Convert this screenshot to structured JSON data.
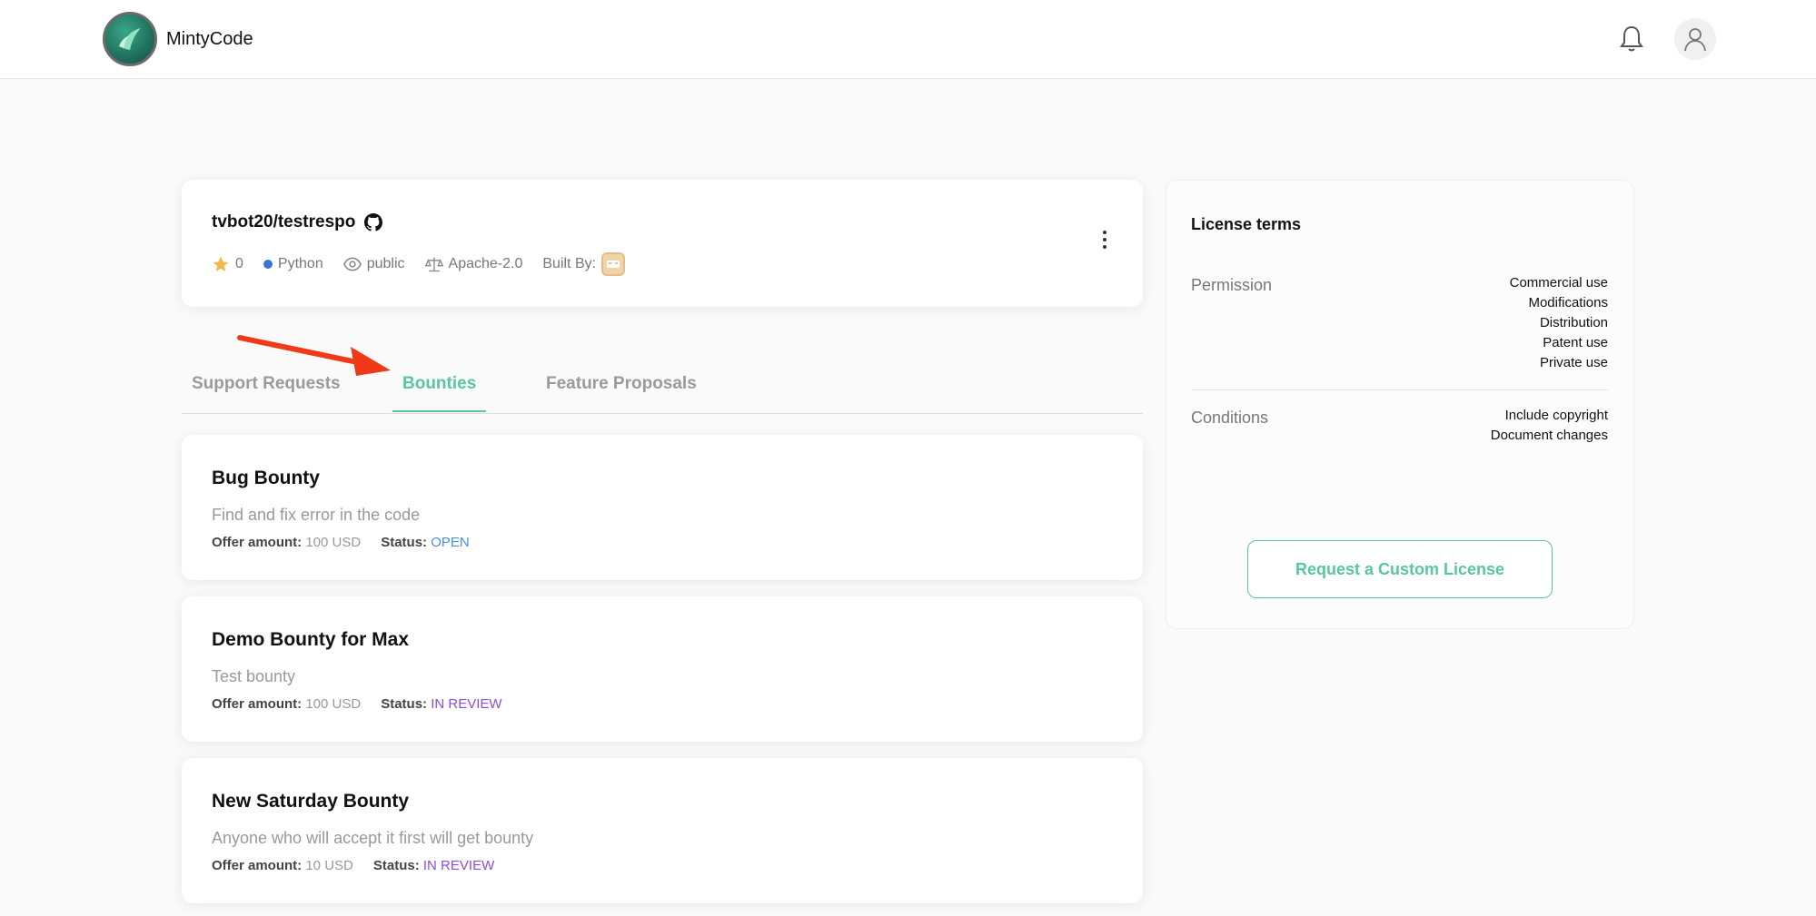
{
  "header": {
    "app_name": "MintyCode"
  },
  "repo": {
    "name": "tvbot20/testrespo",
    "stars": "0",
    "language": "Python",
    "visibility": "public",
    "license": "Apache-2.0",
    "built_by_label": "Built By:"
  },
  "tabs": [
    {
      "label": "Support Requests"
    },
    {
      "label": "Bounties"
    },
    {
      "label": "Feature Proposals"
    }
  ],
  "bounties": [
    {
      "title": "Bug Bounty",
      "description": "Find and fix error in the code",
      "offer_label": "Offer amount:",
      "offer": "100 USD",
      "status_label": "Status:",
      "status": "OPEN"
    },
    {
      "title": "Demo Bounty for Max",
      "description": "Test bounty",
      "offer_label": "Offer amount:",
      "offer": "100 USD",
      "status_label": "Status:",
      "status": "IN REVIEW"
    },
    {
      "title": "New Saturday Bounty",
      "description": "Anyone who will accept it first will get bounty",
      "offer_label": "Offer amount:",
      "offer": "10 USD",
      "status_label": "Status:",
      "status": "IN REVIEW"
    }
  ],
  "license": {
    "title": "License terms",
    "permission_label": "Permission",
    "permissions": [
      "Commercial use",
      "Modifications",
      "Distribution",
      "Patent use",
      "Private use"
    ],
    "conditions_label": "Conditions",
    "conditions": [
      "Include copyright",
      "Document changes"
    ],
    "button_label": "Request a Custom License"
  },
  "colors": {
    "accent": "#58c6a2",
    "open": "#4a90e2",
    "review": "#8a4fd8",
    "arrow": "#f03a17"
  }
}
